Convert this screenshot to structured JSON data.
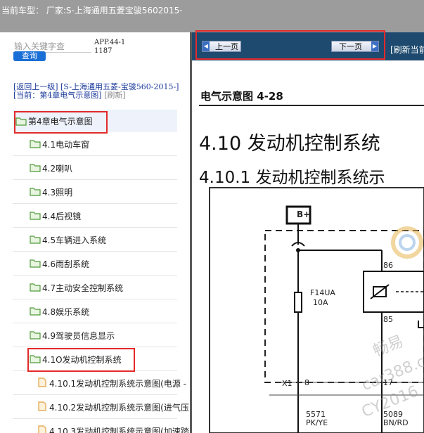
{
  "header": {
    "title": "当前车型： 厂家:S-上海通用五菱宝骏5602015-"
  },
  "search": {
    "placeholder": "输入关键字查",
    "button_label": "查询",
    "app_code": "APP.44-11187"
  },
  "breadcrumb": {
    "back_label": "[返回上一级]",
    "path": "[S-上海通用五菱-宝骏560-2015-]",
    "current_prefix": "[当前：",
    "current": "第4章电气示意图]",
    "refresh": "[刷新]"
  },
  "tree": {
    "root": {
      "label": "第4章电气示意图"
    },
    "items": [
      {
        "label": "4.1电动车窗"
      },
      {
        "label": "4.2喇叭"
      },
      {
        "label": "4.3照明"
      },
      {
        "label": "4.4后视镜"
      },
      {
        "label": "4.5车辆进入系统"
      },
      {
        "label": "4.6雨刮系统"
      },
      {
        "label": "4.7主动安全控制系统"
      },
      {
        "label": "4.8娱乐系统"
      },
      {
        "label": "4.9驾驶员信息显示"
      },
      {
        "label": "4.1O发动机控制系统"
      }
    ],
    "files": [
      {
        "label": "4.10.1发动机控制系统示意图(电源 -"
      },
      {
        "label": "4.10.2发动机控制系统示意图(进气压"
      },
      {
        "label": "4.10.3发动机控制系统示意图(加速踏"
      }
    ]
  },
  "nav": {
    "prev_label": "上一页",
    "next_label": "下一页",
    "refresh_current": "[刷新当前"
  },
  "document": {
    "subtitle": "电气示意图 4-28",
    "heading": "4.10 发动机控制系统",
    "subheading": "4.10.1 发动机控制系统示",
    "diagram": {
      "power_label": "B+",
      "fuse_id": "F14UA",
      "fuse_rating": "10A",
      "relay_pin_top": "86",
      "relay_pin_bottom": "85",
      "connector": "X1",
      "pin_left": "8",
      "pin_right": "17",
      "wire_left_num": "5571",
      "wire_left_color": "PK/YE",
      "wire_right_num": "5089",
      "wire_right_color": "BN/RD"
    },
    "watermark_cn": "畅易",
    "watermark_url": "car388.co",
    "watermark_cy": "CY2016"
  },
  "colors": {
    "accent": "#1a6fd6",
    "highlight_box": "#e32a2a",
    "navbar": "#1d4a6e",
    "folder": "#5cb85c",
    "file": "#f0ad4e"
  }
}
